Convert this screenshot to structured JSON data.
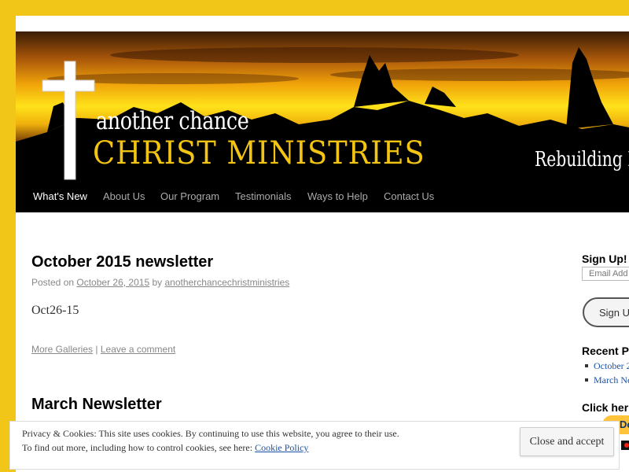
{
  "site": {
    "banner_title_line1": "another chance",
    "banner_title_line2": "CHRIST MINISTRIES",
    "tagline": "Rebuilding Live",
    "colors": {
      "background": "#f1c619",
      "nav": "#000000",
      "accent_gold": "#f3c512",
      "link": "#1b52a8"
    }
  },
  "nav": {
    "items": [
      {
        "label": "What's New",
        "active": true
      },
      {
        "label": "About Us"
      },
      {
        "label": "Our Program"
      },
      {
        "label": "Testimonials"
      },
      {
        "label": "Ways to Help"
      },
      {
        "label": "Contact Us"
      }
    ]
  },
  "posts": [
    {
      "title": "October 2015 newsletter",
      "posted_on": "Posted on",
      "date": "October 26, 2015",
      "by": "by",
      "author": "anotherchancechristministries",
      "content": "Oct26-15",
      "gallery_link": "More Galleries",
      "separator": "|",
      "comment_link": "Leave a comment"
    },
    {
      "title": "March Newsletter"
    }
  ],
  "sidebar": {
    "signup_title": "Sign Up!",
    "email_placeholder": "Email Add",
    "signup_button": "Sign U",
    "recent_title": "Recent P",
    "recent_items": [
      "October 2",
      "March Ne"
    ],
    "click_title": "Click her",
    "donate_label": "Do",
    "icons": [
      "credit-card-icon"
    ]
  },
  "cookie_bar": {
    "line1": "Privacy & Cookies: This site uses cookies. By continuing to use this website, you agree to their use.",
    "line2_prefix": "To find out more, including how to control cookies, see here:",
    "policy_link": "Cookie Policy",
    "close_button": "Close and accept"
  }
}
